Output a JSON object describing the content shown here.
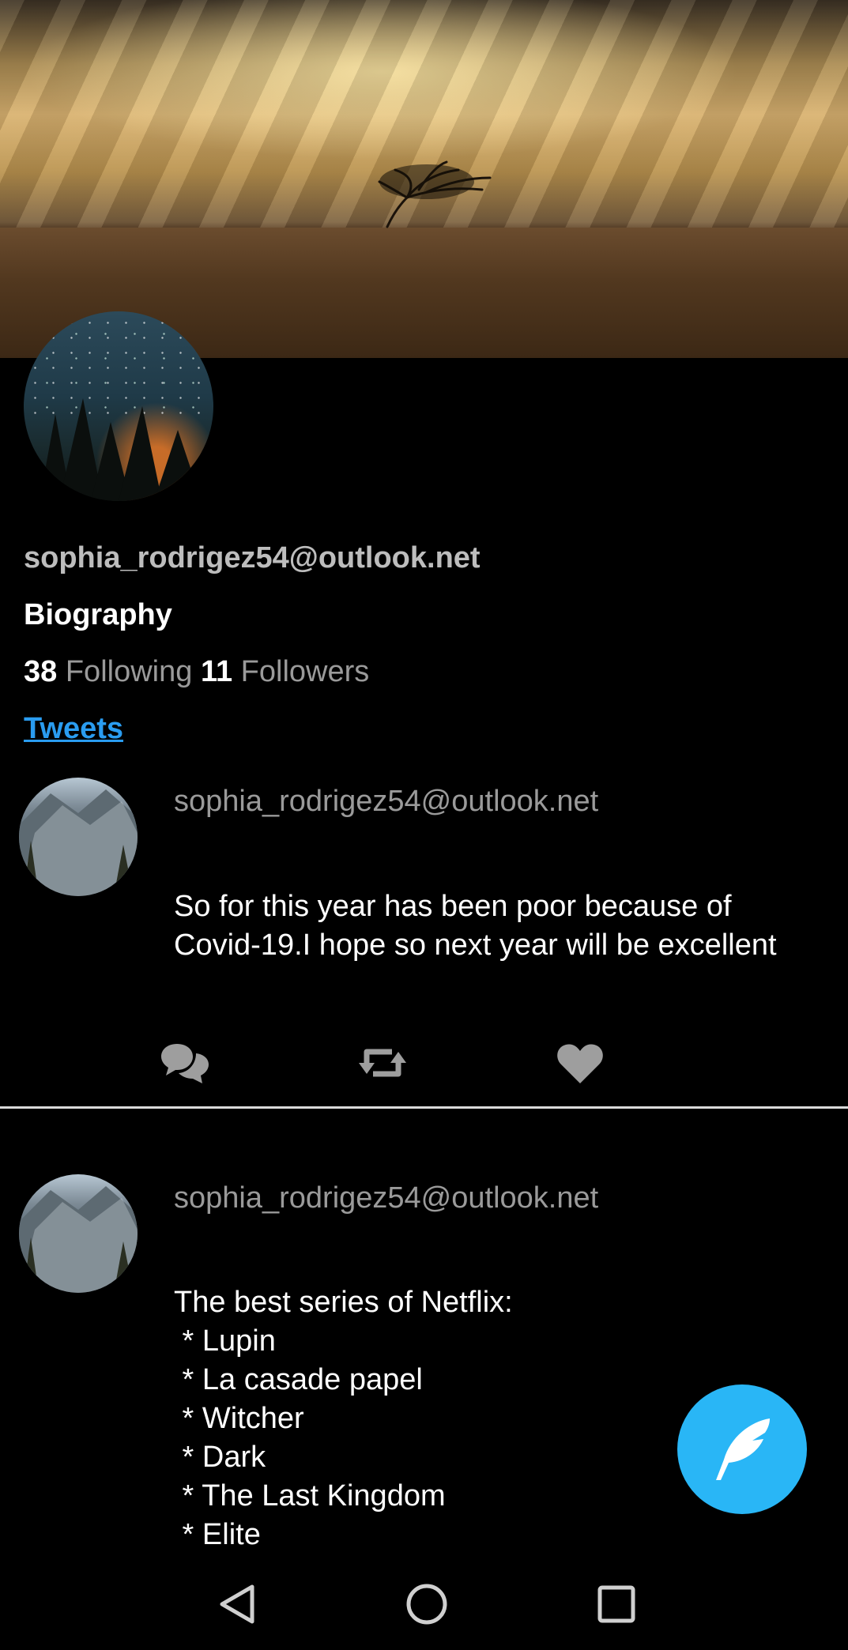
{
  "profile": {
    "email": "sophia_rodrigez54@outlook.net",
    "bio": "Biography",
    "following_count": "38",
    "following_label": "Following",
    "followers_count": "11",
    "followers_label": "Followers",
    "tab_label": "Tweets"
  },
  "tweets": [
    {
      "author": "sophia_rodrigez54@outlook.net",
      "text": "So for this year has been poor because of\nCovid-19.I hope so next year will be excellent",
      "actions": [
        "comment-icon",
        "retweet-icon",
        "heart-icon"
      ]
    },
    {
      "author": "sophia_rodrigez54@outlook.net",
      "text": "The best series of Netflix:\n * Lupin\n * La casade papel\n * Witcher\n * Dark\n * The Last Kingdom\n * Elite"
    }
  ],
  "fab": {
    "icon": "feather-icon",
    "color": "#29b6f6"
  },
  "nav": [
    "back-icon",
    "home-icon",
    "recents-icon"
  ],
  "colors": {
    "accent": "#2a9cf0",
    "muted": "#9a9a9a",
    "background": "#000000"
  }
}
